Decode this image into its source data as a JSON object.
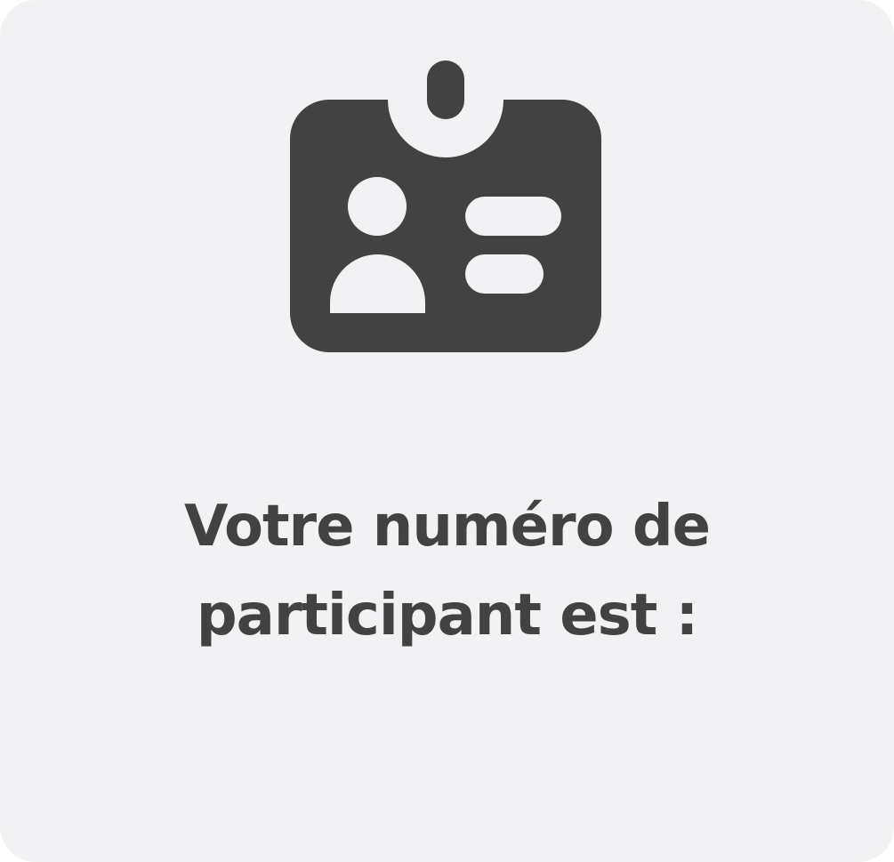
{
  "card": {
    "icon": "participant-badge-icon",
    "message_line_1": "Votre numéro de",
    "message_line_2": "participant est :",
    "colors": {
      "background": "#f2f2f4",
      "foreground": "#424242"
    }
  }
}
